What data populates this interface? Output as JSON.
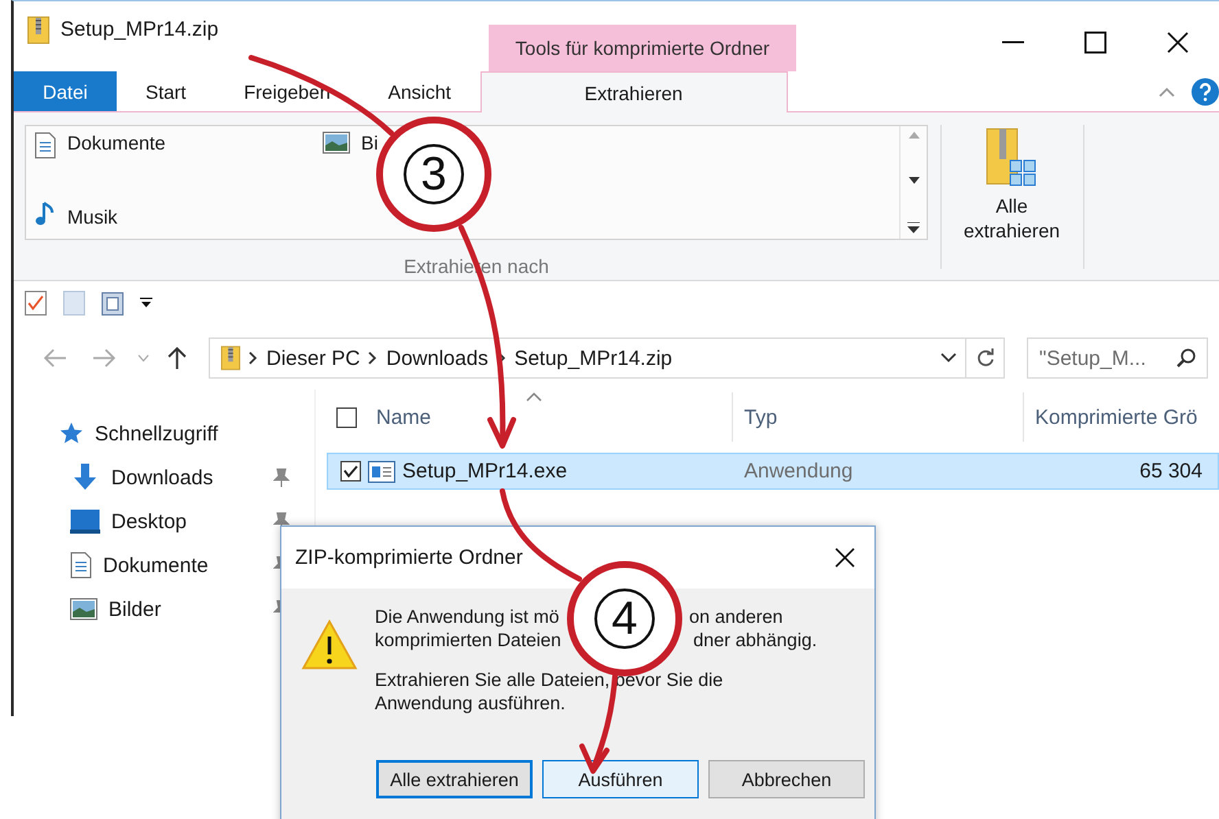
{
  "window": {
    "title": "Setup_MPr14.zip",
    "context_tab_group": "Tools für komprimierte Ordner"
  },
  "ribbon_tabs": [
    {
      "label": "Datei",
      "kind": "file",
      "selected": false
    },
    {
      "label": "Start",
      "kind": "tab",
      "selected": false
    },
    {
      "label": "Freigeben",
      "kind": "tab",
      "selected": false
    },
    {
      "label": "Ansicht",
      "kind": "tab",
      "selected": false
    },
    {
      "label": "Extrahieren",
      "kind": "tab",
      "selected": true
    }
  ],
  "ribbon": {
    "destinations": [
      {
        "label": "Dokumente",
        "kind": "document"
      },
      {
        "label": "Bi",
        "kind": "image"
      },
      {
        "label": "Musik",
        "kind": "music"
      }
    ],
    "group_label": "Extrahieren nach",
    "extract_all": "Alle extrahieren"
  },
  "address_bar": {
    "path": [
      "Dieser PC",
      "Downloads",
      "Setup_MPr14.zip"
    ]
  },
  "search": {
    "placeholder": "\"Setup_M..."
  },
  "navigation": {
    "quick_access": "Schnellzugriff",
    "items": [
      {
        "label": "Downloads",
        "kind": "downloads",
        "pinned": true
      },
      {
        "label": "Desktop",
        "kind": "desktop",
        "pinned": true
      },
      {
        "label": "Dokumente",
        "kind": "document",
        "pinned": true
      },
      {
        "label": "Bilder",
        "kind": "image",
        "pinned": true
      }
    ]
  },
  "file_list": {
    "select_all_checked": false,
    "columns": [
      "Name",
      "Typ",
      "Komprimierte Grö"
    ],
    "rows": [
      {
        "name": "Setup_MPr14.exe",
        "type": "Anwendung",
        "size": "65 304",
        "selected": true,
        "checked": true
      }
    ]
  },
  "dialog": {
    "title": "ZIP-komprimierte Ordner",
    "message_lines": [
      {
        "before": "Die Anwendung ist mö",
        "after": "on anderen"
      },
      {
        "before": "komprimierten Dateien",
        "after": "dner abhängig."
      }
    ],
    "instruction": "Extrahieren Sie alle Dateien, bevor Sie die Anwendung ausführen.",
    "buttons": [
      {
        "label": "Alle extrahieren",
        "kind": "default"
      },
      {
        "label": "Ausführen",
        "kind": "hover"
      },
      {
        "label": "Abbrechen",
        "kind": "normal"
      }
    ]
  },
  "annotations": [
    {
      "number": "3"
    },
    {
      "number": "4"
    }
  ]
}
